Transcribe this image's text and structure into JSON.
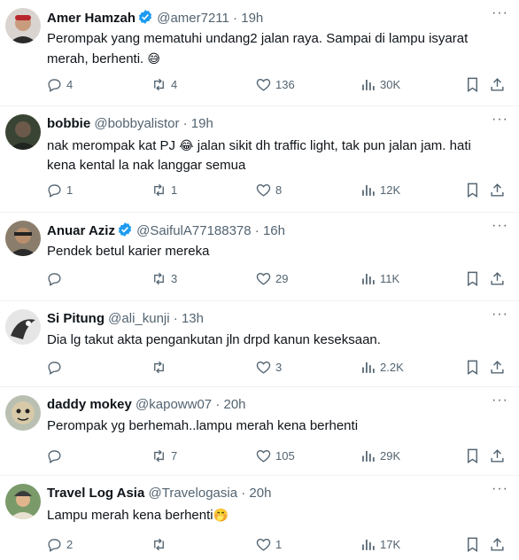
{
  "tweets": [
    {
      "name": "Amer Hamzah",
      "verified": true,
      "handle": "@amer7211",
      "time": "19h",
      "text": "Perompak yang mematuhi undang2 jalan raya. Sampai di lampu isyarat merah, berhenti.",
      "emoji": "😅",
      "replies": "4",
      "retweets": "4",
      "likes": "136",
      "views": "30K"
    },
    {
      "name": "bobbie",
      "verified": false,
      "handle": "@bobbyalistor",
      "time": "19h",
      "text_before": "nak merompak kat PJ ",
      "emoji": "😂",
      "text_after": " jalan sikit dh traffic light, tak pun jalan jam. hati kena kental la nak langgar semua",
      "replies": "1",
      "retweets": "1",
      "likes": "8",
      "views": "12K"
    },
    {
      "name": "Anuar Aziz",
      "verified": true,
      "handle": "@SaifulA77188378",
      "time": "16h",
      "text": "Pendek betul karier mereka",
      "replies": "",
      "retweets": "3",
      "likes": "29",
      "views": "11K"
    },
    {
      "name": "Si Pitung",
      "verified": false,
      "handle": "@ali_kunji",
      "time": "13h",
      "text": "Dia lg takut akta pengankutan jln drpd kanun keseksaan.",
      "replies": "",
      "retweets": "",
      "likes": "3",
      "views": "2.2K"
    },
    {
      "name": "daddy mokey",
      "verified": false,
      "handle": "@kapoww07",
      "time": "20h",
      "text": "Perompak yg berhemah..lampu merah kena berhenti",
      "replies": "",
      "retweets": "7",
      "likes": "105",
      "views": "29K"
    },
    {
      "name": "Travel Log Asia",
      "verified": false,
      "handle": "@Travelogasia",
      "time": "20h",
      "text": "Lampu merah kena berhenti",
      "emoji": "🤭",
      "replies": "2",
      "retweets": "",
      "likes": "1",
      "views": "17K"
    }
  ],
  "colors": {
    "text": "#0f1419",
    "secondary": "#536471",
    "verified": "#1d9bf0",
    "divider": "#eff3f4"
  }
}
